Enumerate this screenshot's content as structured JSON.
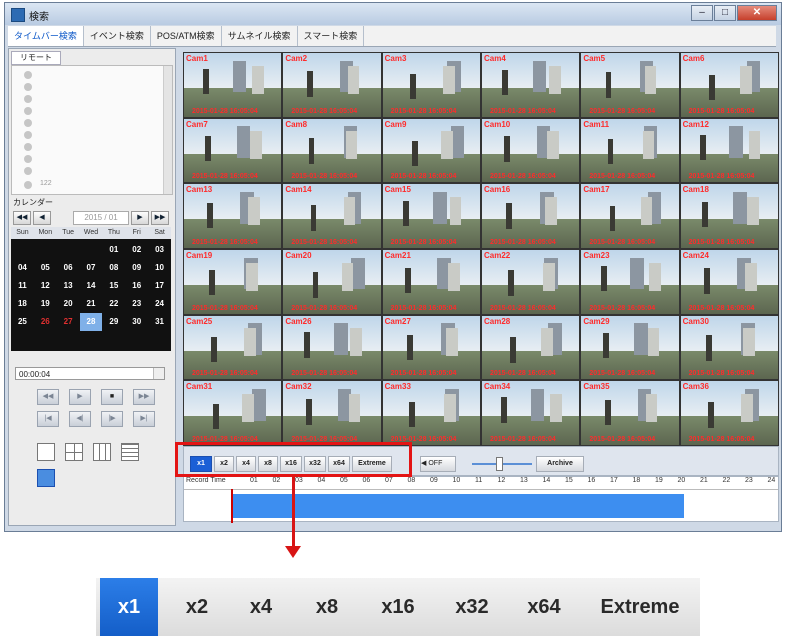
{
  "window": {
    "title": "検索"
  },
  "tabs": [
    "タイムバー検索",
    "イベント検索",
    "POS/ATM検索",
    "サムネイル検索",
    "スマート検索"
  ],
  "sidebar": {
    "remote_label": "リモート",
    "tree_last_item": "122",
    "calendar_label": "カレンダー",
    "month": "2015 / 01",
    "weekdays": [
      "Sun",
      "Mon",
      "Tue",
      "Wed",
      "Thu",
      "Fri",
      "Sat"
    ],
    "days": [
      "",
      "",
      "",
      "",
      "01",
      "02",
      "03",
      "04",
      "05",
      "06",
      "07",
      "08",
      "09",
      "10",
      "11",
      "12",
      "13",
      "14",
      "15",
      "16",
      "17",
      "18",
      "19",
      "20",
      "21",
      "22",
      "23",
      "24",
      "25",
      "26",
      "27",
      "28",
      "29",
      "30",
      "31"
    ],
    "selected_day": "28",
    "red_days": [
      "26",
      "27"
    ],
    "time_value": "00:00:04"
  },
  "cameras": [
    {
      "name": "Cam1",
      "ts": "2015-01-28 16:05:04"
    },
    {
      "name": "Cam2",
      "ts": "2015-01-28 16:05:04"
    },
    {
      "name": "Cam3",
      "ts": "2015-01-28 16:05:04"
    },
    {
      "name": "Cam4",
      "ts": "2015-01-28 16:05:04"
    },
    {
      "name": "Cam5",
      "ts": "2015-01-28 16:05:04"
    },
    {
      "name": "Cam6",
      "ts": "2015-01-28 16:05:04"
    },
    {
      "name": "Cam7",
      "ts": "2015-01-28 16:05:04"
    },
    {
      "name": "Cam8",
      "ts": "2015-01-28 16:05:04"
    },
    {
      "name": "Cam9",
      "ts": "2015-01-28 16:05:04"
    },
    {
      "name": "Cam10",
      "ts": "2015-01-28 16:05:04"
    },
    {
      "name": "Cam11",
      "ts": "2015-01-28 16:05:04"
    },
    {
      "name": "Cam12",
      "ts": "2015-01-28 16:05:04"
    },
    {
      "name": "Cam13",
      "ts": "2015-01-28 16:05:04"
    },
    {
      "name": "Cam14",
      "ts": "2015-01-28 16:05:04"
    },
    {
      "name": "Cam15",
      "ts": "2015-01-28 16:05:04"
    },
    {
      "name": "Cam16",
      "ts": "2015-01-28 16:05:04"
    },
    {
      "name": "Cam17",
      "ts": "2015-01-28 16:05:04"
    },
    {
      "name": "Cam18",
      "ts": "2015-01-28 16:05:04"
    },
    {
      "name": "Cam19",
      "ts": "2015-01-28 16:05:04"
    },
    {
      "name": "Cam20",
      "ts": "2015-01-28 16:05:04"
    },
    {
      "name": "Cam21",
      "ts": "2015-01-28 16:05:04"
    },
    {
      "name": "Cam22",
      "ts": "2015-01-28 16:05:04"
    },
    {
      "name": "Cam23",
      "ts": "2015-01-28 16:05:04"
    },
    {
      "name": "Cam24",
      "ts": "2015-01-28 16:05:04"
    },
    {
      "name": "Cam25",
      "ts": "2015-01-28 16:05:04"
    },
    {
      "name": "Cam26",
      "ts": "2015-01-28 16:05:04"
    },
    {
      "name": "Cam27",
      "ts": "2015-01-28 16:05:04"
    },
    {
      "name": "Cam28",
      "ts": "2015-01-28 16:05:04"
    },
    {
      "name": "Cam29",
      "ts": "2015-01-28 16:05:04"
    },
    {
      "name": "Cam30",
      "ts": "2015-01-28 16:05:04"
    },
    {
      "name": "Cam31",
      "ts": "2015-01-28 16:05:04"
    },
    {
      "name": "Cam32",
      "ts": "2015-01-28 16:05:04"
    },
    {
      "name": "Cam33",
      "ts": "2015-01-28 16:05:04"
    },
    {
      "name": "Cam34",
      "ts": "2015-01-28 16:05:04"
    },
    {
      "name": "Cam35",
      "ts": "2015-01-28 16:05:04"
    },
    {
      "name": "Cam36",
      "ts": "2015-01-28 16:05:04"
    }
  ],
  "speed_buttons": [
    "x1",
    "x2",
    "x4",
    "x8",
    "x16",
    "x32",
    "x64",
    "Extreme"
  ],
  "active_speed": "x1",
  "audio_label": "OFF",
  "archive_label": "Archive",
  "timeline": {
    "label": "Record Time",
    "hours": [
      "01",
      "02",
      "03",
      "04",
      "05",
      "06",
      "07",
      "08",
      "09",
      "10",
      "11",
      "12",
      "13",
      "14",
      "15",
      "16",
      "17",
      "18",
      "19",
      "20",
      "21",
      "22",
      "23",
      "24"
    ]
  },
  "zoom_speed_buttons": [
    "x1",
    "x2",
    "x4",
    "x8",
    "x16",
    "x32",
    "x64",
    "Extreme"
  ],
  "colors": {
    "accent": "#1b5fd6",
    "highlight_box": "#e31414",
    "record_bar": "#3d8ef0",
    "camera_label": "#ff2b2b"
  }
}
